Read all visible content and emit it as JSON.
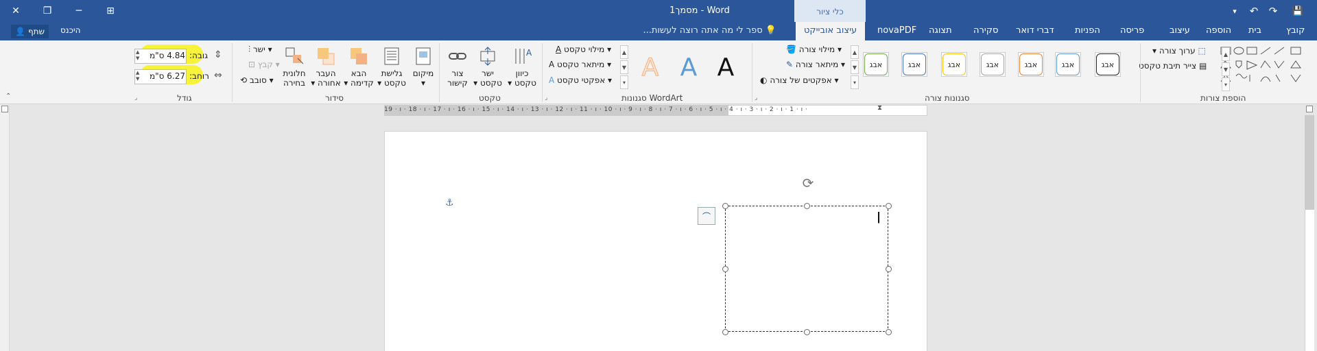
{
  "titlebar": {
    "title": "מסמך1 - Word",
    "context_group": "כלי ציור",
    "close_glyph": "✕",
    "restore_glyph": "❐",
    "minimize_glyph": "─",
    "ribbon_opts_glyph": "⊞",
    "save_glyph": "💾",
    "redo_glyph": "↷",
    "undo_glyph": "↶",
    "customize_glyph": "▾"
  },
  "tabs": [
    "קובץ",
    "בית",
    "הוספה",
    "עיצוב",
    "פריסה",
    "הפניות",
    "דברי דואר",
    "סקירה",
    "תצוגה",
    "novaPDF",
    "עיצוב אובייקט"
  ],
  "active_tab": "עיצוב אובייקט",
  "tell_me": "ספר לי מה אתה רוצה לעשות...",
  "share_label": "שתף",
  "signin_label": "היכנס",
  "groups": {
    "insert_shapes": "הוספת צורות",
    "shape_styles": "סגנונות צורה",
    "wordart_styles": "סגנונות WordArt",
    "text": "טקסט",
    "arrange": "סידור",
    "size": "גודל"
  },
  "insert_shapes": {
    "edit_shape": "ערוך צורה",
    "draw_textbox": "צייר תיבת טקסט"
  },
  "shape_styles": {
    "tile_text": "אבג",
    "tile_colors": [
      "#222222",
      "#5b9bd5",
      "#ed7d31",
      "#a5a5a5",
      "#ffc000",
      "#4472c4",
      "#70ad47"
    ],
    "fill": "מילוי צורה",
    "outline": "מיתאר צורה",
    "effects": "אפקטים של צורה"
  },
  "wordart": {
    "letter": "A",
    "colors": [
      "#111111",
      "#5b9bd5",
      "#f4b183"
    ],
    "text_fill": "מילוי טקסט",
    "text_outline": "מיתאר טקסט",
    "text_effects": "אפקטי טקסט"
  },
  "text_group": {
    "direction": [
      "כיוון",
      "טקסט"
    ],
    "align": [
      "ישר",
      "טקסט"
    ],
    "link": [
      "צור",
      "קישור"
    ]
  },
  "arrange": {
    "position": "מיקום",
    "wrap": [
      "גלישת",
      "טקסט"
    ],
    "forward": [
      "הבא",
      "קדימה"
    ],
    "backward": [
      "העבר",
      "אחורה"
    ],
    "pane": [
      "חלונית",
      "בחירה"
    ],
    "align": "ישר",
    "group": "קבץ",
    "rotate": "סובב"
  },
  "size": {
    "height_label": "גובה:",
    "height_value": "4.84 ס\"מ",
    "width_label": "רוחב:",
    "width_value": "6.27 ס\"מ",
    "highlight_color": "#f7f33a"
  },
  "ruler": {
    "numbers": "19 · ı · 18 · ı · 17 · ı · 16 · ı · 15 · ı · 14 · ı · 13 · ı · 12 · ı · 11 · ı · 10 · ı · 9 · ı · 8 · ı · 7 · ı · 6 · ı · 5 · ı · 4 · ı · 3 · ı · 2 · ı · 1 · ı ·"
  },
  "document": {
    "textbox_text": "ן",
    "anchor_glyph": "⚓",
    "rotate_glyph": "⟳",
    "layout_glyph": "⌒"
  }
}
